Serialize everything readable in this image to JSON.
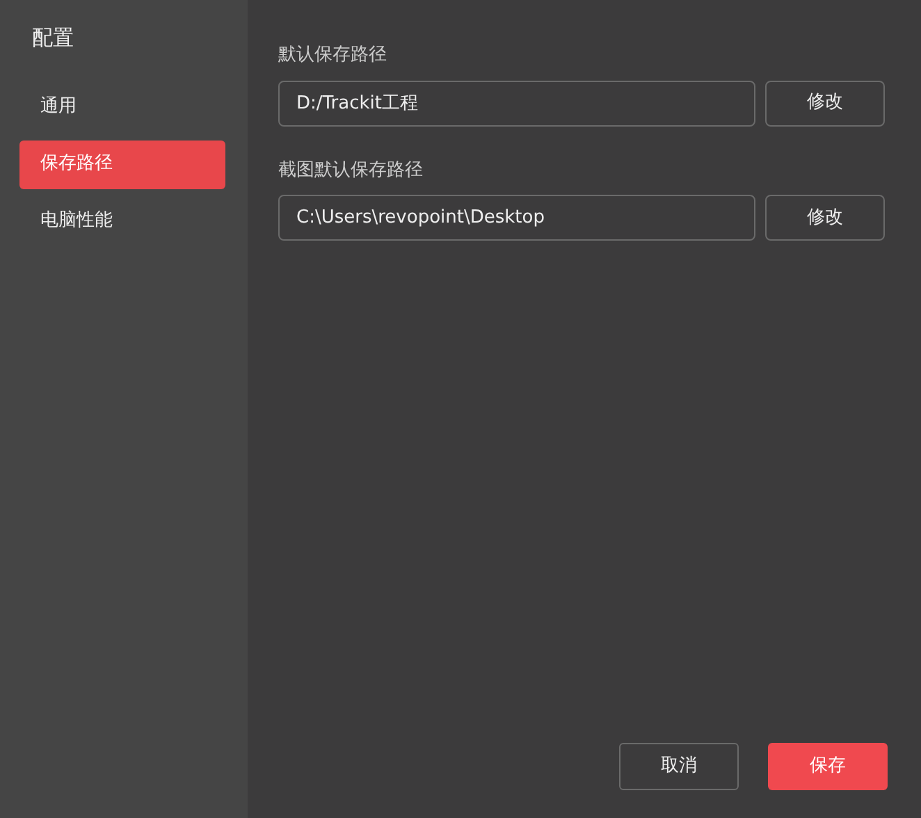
{
  "sidebar": {
    "title": "配置",
    "items": [
      {
        "label": "通用",
        "selected": false
      },
      {
        "label": "保存路径",
        "selected": true
      },
      {
        "label": "电脑性能",
        "selected": false
      }
    ]
  },
  "paths": [
    {
      "label": "默认保存路径",
      "value": "D:/Trackit工程",
      "button": "修改"
    },
    {
      "label": "截图默认保存路径",
      "value": "C:\\Users\\revopoint\\Desktop",
      "button": "修改"
    }
  ],
  "footer": {
    "cancel": "取消",
    "save": "保存"
  }
}
